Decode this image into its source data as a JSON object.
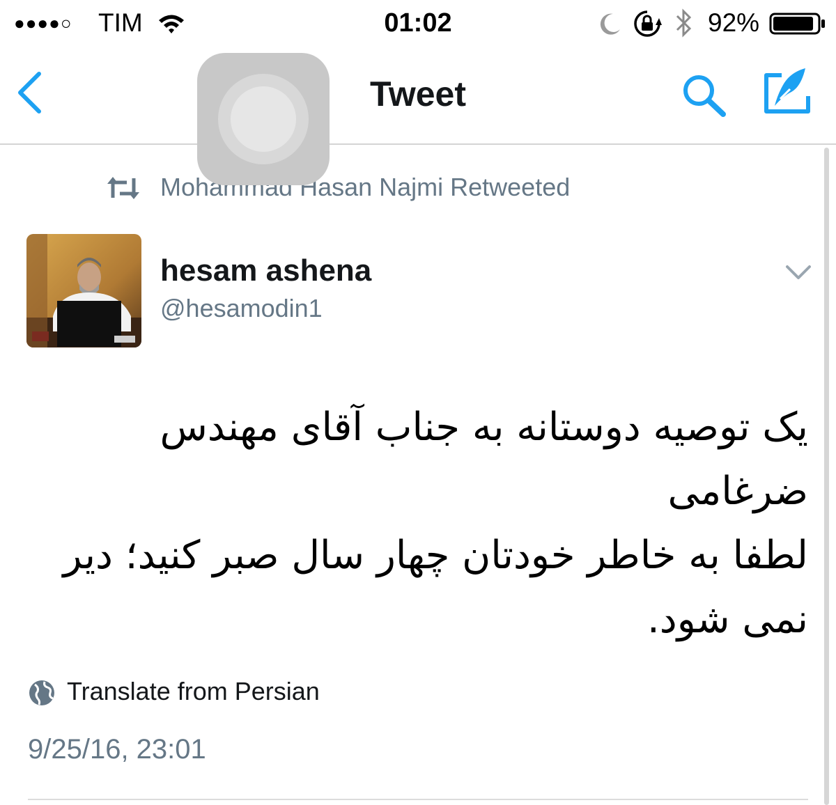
{
  "status_bar": {
    "signal": "●●●●○",
    "carrier": "TIM",
    "time": "01:02",
    "battery_percent": "92%",
    "battery_level": 0.92,
    "icons": [
      "wifi-icon",
      "moon-icon",
      "lock-rotation-icon",
      "bluetooth-icon",
      "battery-icon"
    ]
  },
  "nav": {
    "title": "Tweet",
    "back_icon": "back-icon",
    "search_icon": "search-icon",
    "compose_icon": "compose-icon"
  },
  "tweet": {
    "retweet_context": "Mohammad Hasan Najmi Retweeted",
    "author_name": "hesam ashena",
    "author_handle": "@hesamodin1",
    "text": "یک توصیه دوستانه به جناب آقای مهندس ضرغامی\nلطفا به خاطر خودتان چهار سال صبر کنید؛ دیر نمی شود.",
    "translate_label": "Translate from Persian",
    "timestamp": "9/25/16, 23:01"
  },
  "colors": {
    "accent": "#1da1f2",
    "secondary_text": "#657786",
    "primary_text": "#14171a"
  }
}
